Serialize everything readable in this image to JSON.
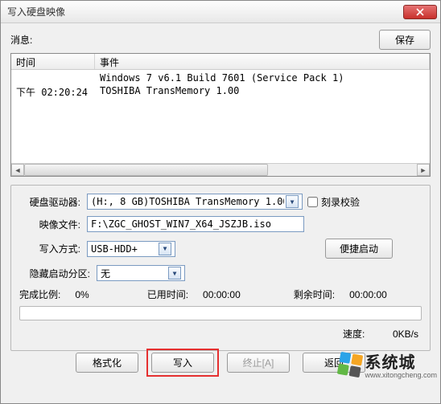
{
  "window": {
    "title": "写入硬盘映像"
  },
  "top": {
    "messages_label": "消息:",
    "save_btn": "保存"
  },
  "list": {
    "headers": {
      "time": "时间",
      "event": "事件"
    },
    "rows": [
      {
        "time": "",
        "event": "Windows 7 v6.1 Build 7601 (Service Pack 1)"
      },
      {
        "time": "下午 02:20:24",
        "event": "TOSHIBA TransMemory    1.00"
      }
    ]
  },
  "form": {
    "drive_label": "硬盘驱动器:",
    "drive_value": "(H:, 8 GB)TOSHIBA TransMemory    1.00",
    "verify_label": "刻录校验",
    "image_label": "映像文件:",
    "image_value": "F:\\ZGC_GHOST_WIN7_X64_JSZJB.iso",
    "mode_label": "写入方式:",
    "mode_value": "USB-HDD+",
    "quickboot_btn": "便捷启动",
    "hidden_label": "隐藏启动分区:",
    "hidden_value": "无"
  },
  "status": {
    "done_label": "完成比例:",
    "done_value": "0%",
    "used_label": "已用时间:",
    "used_value": "00:00:00",
    "remain_label": "剩余时间:",
    "remain_value": "00:00:00",
    "speed_label": "速度:",
    "speed_value": "0KB/s"
  },
  "buttons": {
    "format": "格式化",
    "write": "写入",
    "abort": "终止[A]",
    "back": "返回"
  },
  "watermark": {
    "brand": "系统城",
    "url": "www.xitongcheng.com"
  }
}
